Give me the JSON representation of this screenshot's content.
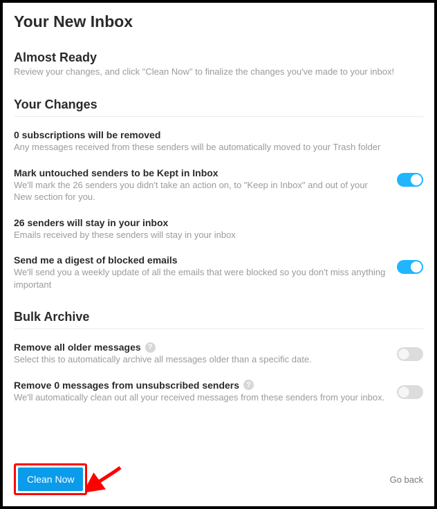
{
  "page": {
    "title": "Your New Inbox"
  },
  "intro": {
    "heading": "Almost Ready",
    "desc": "Review your changes, and click \"Clean Now\" to finalize the changes you've made to your inbox!"
  },
  "changes": {
    "heading": "Your Changes",
    "items": [
      {
        "title": "0 subscriptions will be removed",
        "desc": "Any messages received from these senders will be automatically moved to your Trash folder",
        "toggle": null
      },
      {
        "title": "Mark untouched senders to be Kept in Inbox",
        "desc": "We'll mark the 26 senders you didn't take an action on, to \"Keep in Inbox\" and out of your New section for you.",
        "toggle": "on"
      },
      {
        "title": "26 senders will stay in your inbox",
        "desc": "Emails received by these senders will stay in your inbox",
        "toggle": null
      },
      {
        "title": "Send me a digest of blocked emails",
        "desc": "We'll send you a weekly update of all the emails that were blocked so you don't miss anything important",
        "toggle": "on"
      }
    ]
  },
  "bulk": {
    "heading": "Bulk Archive",
    "items": [
      {
        "title": "Remove all older messages",
        "desc": "Select this to automatically archive all messages older than a specific date.",
        "help": true,
        "toggle": "off"
      },
      {
        "title": "Remove 0 messages from unsubscribed senders",
        "desc": "We'll automatically clean out all your received messages from these senders from your inbox.",
        "help": true,
        "toggle": "off"
      }
    ]
  },
  "footer": {
    "primary": "Clean Now",
    "secondary": "Go back"
  }
}
